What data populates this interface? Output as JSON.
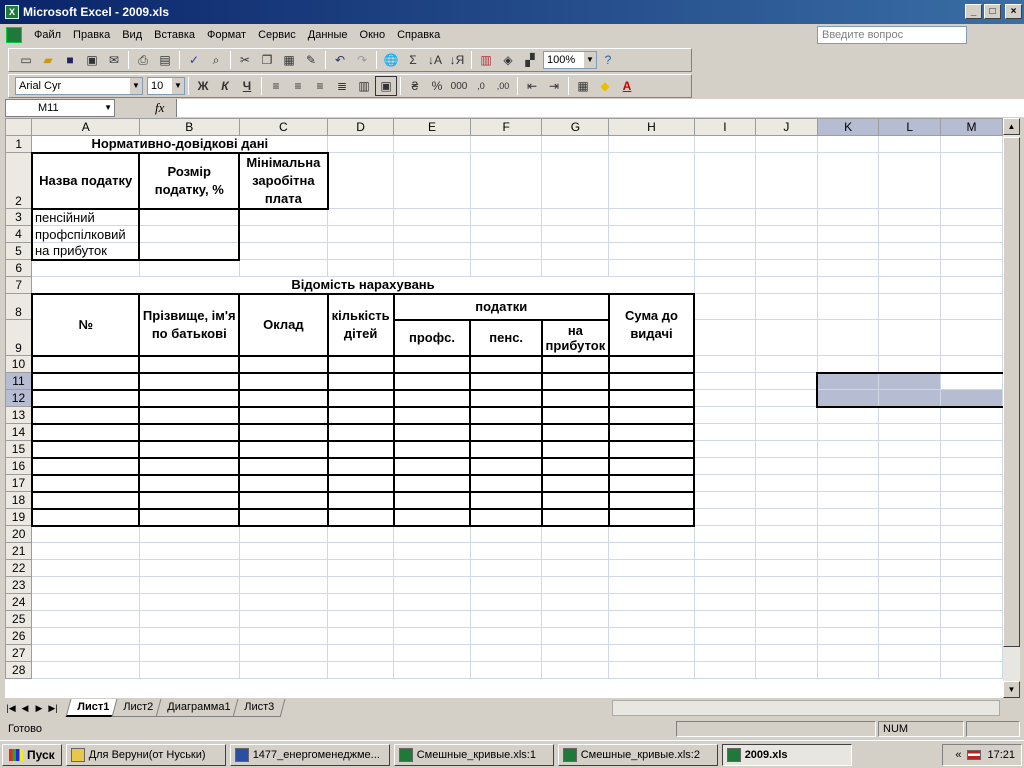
{
  "window": {
    "title": "Microsoft Excel - 2009.xls"
  },
  "menu": [
    "Файл",
    "Правка",
    "Вид",
    "Вставка",
    "Формат",
    "Сервис",
    "Данные",
    "Окно",
    "Справка"
  ],
  "help_placeholder": "Введите вопрос",
  "toolbar": {
    "zoom": "100%",
    "font": "Arial Cyr",
    "size": "10",
    "bold": "Ж",
    "italic": "К",
    "underline": "Ч",
    "percent": "%",
    "thousands": "000",
    "sigma": "Σ",
    "font_color": "A"
  },
  "namebox": "M11",
  "fx": "fx",
  "columns": [
    "A",
    "B",
    "C",
    "D",
    "E",
    "F",
    "G",
    "H",
    "I",
    "J",
    "K",
    "L",
    "M"
  ],
  "rows": [
    "1",
    "2",
    "3",
    "4",
    "5",
    "6",
    "7",
    "8",
    "9",
    "10",
    "11",
    "12",
    "13",
    "14",
    "15",
    "16",
    "17",
    "18",
    "19",
    "20",
    "21",
    "22",
    "23",
    "24",
    "25",
    "26",
    "27",
    "28"
  ],
  "sheet": {
    "r1": "Нормативно-довідкові дані",
    "h_tax_name": "Назва податку",
    "h_tax_size": "Розмір податку, %",
    "h_min_wage": "Мінімальна заробітна плата",
    "tax1": "пенсійний",
    "tax2": "профспілковий",
    "tax3": "на прибуток",
    "r7": "Відомість нарахувань",
    "h_num": "№",
    "h_name": "Прізвище, ім'я по батькові",
    "h_salary": "Оклад",
    "h_children": "кількість дітей",
    "h_taxes": "податки",
    "h_prof": "профс.",
    "h_pens": "пенс.",
    "h_profit": "на прибуток",
    "h_total": "Сума до видачі"
  },
  "tabs": [
    "Лист1",
    "Лист2",
    "Диаграмма1",
    "Лист3"
  ],
  "status": {
    "message": "Готово",
    "num": "NUM"
  },
  "taskbar": {
    "start": "Пуск",
    "tasks": [
      "Для Веруни(от Нуськи)",
      "1477_енергоменеджме...",
      "Смешные_кривые.xls:1",
      "Смешные_кривые.xls:2",
      "2009.xls"
    ],
    "clock": "17:21",
    "lang": "«"
  },
  "colors": {
    "title_grad_start": "#0a246a",
    "title_grad_end": "#3a6ea5",
    "selection": "#b6bcd2"
  }
}
